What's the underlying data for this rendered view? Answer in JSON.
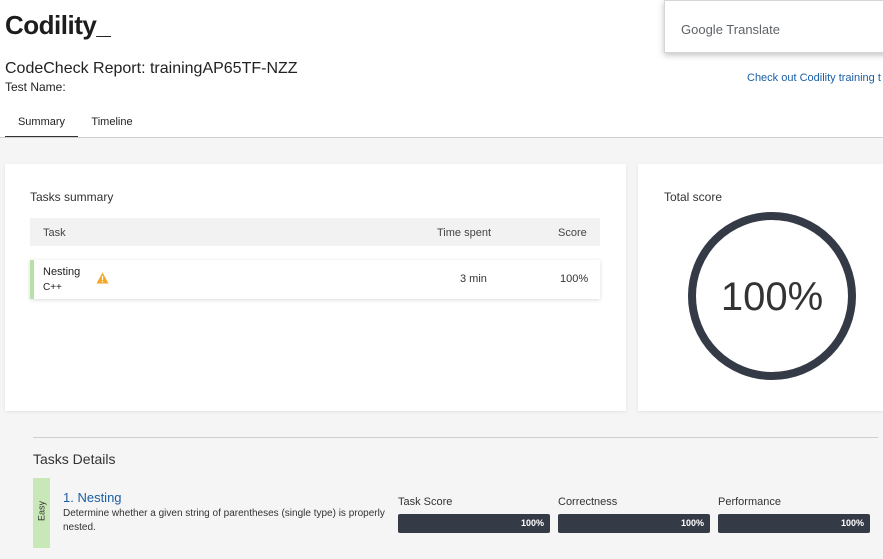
{
  "header": {
    "logo": "Codility_",
    "report_title": "CodeCheck Report: trainingAP65TF-NZZ",
    "test_name_label": "Test Name:",
    "training_link": "Check out Codility training t"
  },
  "google_translate": {
    "label": "Google Translate"
  },
  "tabs": [
    {
      "label": "Summary",
      "active": true
    },
    {
      "label": "Timeline",
      "active": false
    }
  ],
  "tasks_summary": {
    "title": "Tasks summary",
    "columns": {
      "task": "Task",
      "time_spent": "Time spent",
      "score": "Score"
    },
    "rows": [
      {
        "name": "Nesting",
        "language": "C++",
        "warning_icon": "warning-icon",
        "time_spent": "3 min",
        "score": "100%"
      }
    ]
  },
  "total_score": {
    "title": "Total score",
    "value": "100%",
    "fraction": 1.0
  },
  "tasks_details": {
    "title": "Tasks Details",
    "tasks": [
      {
        "difficulty": "Easy",
        "title": "1. Nesting",
        "description": "Determine whether a given string of parentheses (single type) is properly nested.",
        "metrics": [
          {
            "label": "Task Score",
            "value": "100%",
            "fraction": 1.0
          },
          {
            "label": "Correctness",
            "value": "100%",
            "fraction": 1.0
          },
          {
            "label": "Performance",
            "value": "100%",
            "fraction": 1.0
          }
        ]
      }
    ]
  },
  "colors": {
    "accent_dark": "#353a47",
    "link_blue": "#1a5fa6",
    "easy_green": "#c9e8b8",
    "warning_orange": "#f5a623"
  }
}
